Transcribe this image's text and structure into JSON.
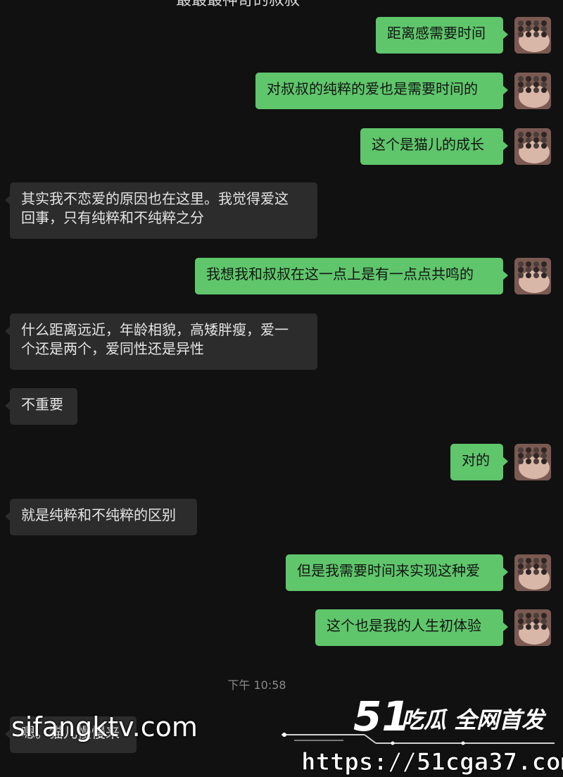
{
  "chat": {
    "title": "最最最神奇的叔叔",
    "messages": [
      {
        "side": "out",
        "text": "距离感需要时间"
      },
      {
        "side": "out",
        "text": "对叔叔的纯粹的爱也是需要时间的"
      },
      {
        "side": "out",
        "text": "这个是猫儿的成长"
      },
      {
        "side": "in",
        "text": "其实我不恋爱的原因也在这里。我觉得爱这\n回事，只有纯粹和不纯粹之分"
      },
      {
        "side": "out",
        "text": "我想我和叔叔在这一点上是有一点点共鸣的"
      },
      {
        "side": "in",
        "text": "什么距离远近，年龄相貌，高矮胖瘦，爱一\n个还是两个，爱同性还是异性"
      },
      {
        "side": "in",
        "text": "不重要"
      },
      {
        "side": "out",
        "text": "对的"
      },
      {
        "side": "in",
        "text": "就是纯粹和不纯粹的区别"
      },
      {
        "side": "out",
        "text": "但是我需要时间来实现这种爱"
      },
      {
        "side": "out",
        "text": "这个也是我的人生初体验"
      },
      {
        "side": "in",
        "text": "嗯。猫儿慢慢来"
      }
    ],
    "timestamp": "下午 10:58"
  },
  "watermark": {
    "site_text": "sifangktv.com",
    "logo_number": "51",
    "logo_text": "吃瓜 全网首发",
    "logo_url": "https://51cga37.com"
  },
  "colors": {
    "background": "#111111",
    "outgoing_bubble": "#5fc66b",
    "incoming_bubble": "#2c2c2c"
  }
}
